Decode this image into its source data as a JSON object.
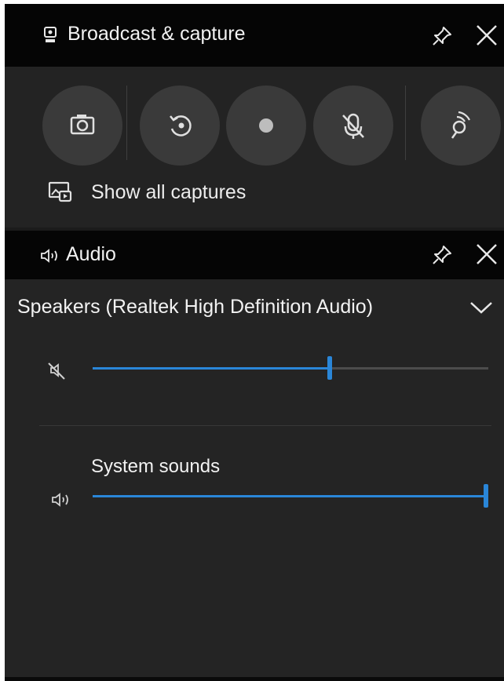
{
  "broadcast": {
    "title": "Broadcast & capture",
    "show_all_label": "Show all captures",
    "buttons": [
      {
        "name": "screenshot",
        "icon": "camera-icon"
      },
      {
        "name": "record-last",
        "icon": "record-last-icon"
      },
      {
        "name": "start-recording",
        "icon": "record-dot-icon"
      },
      {
        "name": "mic",
        "icon": "mic-off-icon"
      },
      {
        "name": "broadcast",
        "icon": "broadcast-icon"
      }
    ]
  },
  "audio": {
    "title": "Audio",
    "device": "Speakers (Realtek High Definition Audio)",
    "mixer": [
      {
        "name": "",
        "icon": "speaker-muted-icon",
        "volume": 0.6
      },
      {
        "name": "System sounds",
        "icon": "speaker-icon",
        "volume": 1.0
      }
    ]
  },
  "colors": {
    "accent": "#2a86d8",
    "header": "#050505",
    "panel": "#232323",
    "button": "#3a3a3a"
  }
}
